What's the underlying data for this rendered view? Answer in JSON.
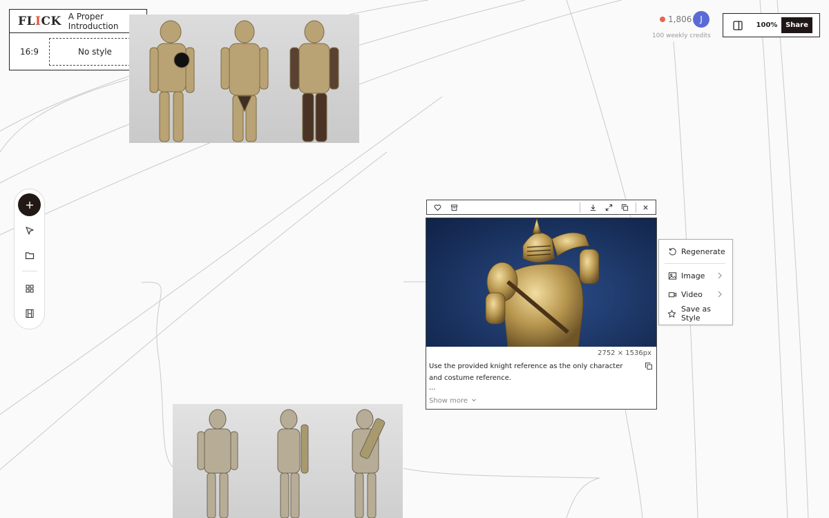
{
  "app": {
    "logo_text": "FLICK",
    "project_title": "A Proper Introduction",
    "aspect_ratio": "16:9",
    "style_label": "No style"
  },
  "account": {
    "credits": "1,806",
    "credits_note": "100 weekly credits",
    "avatar_initial": "J",
    "accent_color": "#e86452",
    "avatar_color": "#5b6bd6"
  },
  "topbar": {
    "zoom": "100%",
    "share_label": "Share"
  },
  "left_toolbar": {
    "tools": [
      "add-icon",
      "pointer-icon",
      "folder-icon",
      "grid-icon",
      "film-icon"
    ]
  },
  "selected_node": {
    "toolbar_icons": [
      "heart-icon",
      "archive-icon",
      "download-icon",
      "expand-icon",
      "duplicate-icon",
      "close-icon"
    ],
    "dimensions": "2752 × 1536px",
    "prompt": "Use the provided knight reference as the only character and costume reference.",
    "ellipsis": "...",
    "show_more": "Show more"
  },
  "context_menu": {
    "items": [
      {
        "label": "Regenerate",
        "icon": "regenerate-icon"
      },
      {
        "label": "Image",
        "icon": "image-icon"
      },
      {
        "label": "Video",
        "icon": "video-icon"
      },
      {
        "label": "Save as Style",
        "icon": "star-icon"
      }
    ]
  }
}
